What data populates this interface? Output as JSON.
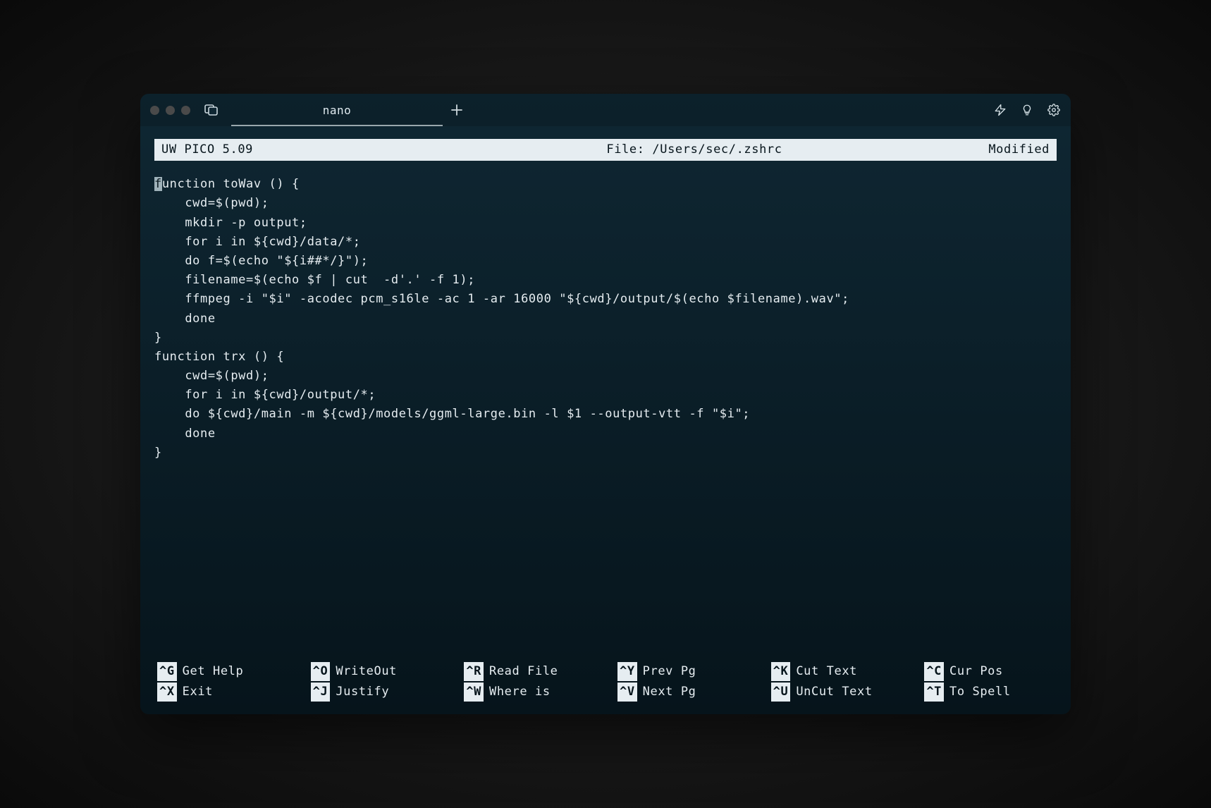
{
  "titlebar": {
    "tab_label": "nano"
  },
  "editor": {
    "app": "UW PICO 5.09",
    "file_label": "File: /Users/sec/.zshrc",
    "modified": "Modified",
    "cursor_char": "f",
    "content_after_cursor": "unction toWav () {\n    cwd=$(pwd);\n    mkdir -p output;\n    for i in ${cwd}/data/*;\n    do f=$(echo \"${i##*/}\");\n    filename=$(echo $f | cut  -d'.' -f 1);\n    ffmpeg -i \"$i\" -acodec pcm_s16le -ac 1 -ar 16000 \"${cwd}/output/$(echo $filename).wav\";\n    done\n}\nfunction trx () {\n    cwd=$(pwd);\n    for i in ${cwd}/output/*;\n    do ${cwd}/main -m ${cwd}/models/ggml-large.bin -l $1 --output-vtt -f \"$i\";\n    done\n}"
  },
  "shortcuts": [
    {
      "key": "^G",
      "label": "Get Help"
    },
    {
      "key": "^X",
      "label": "Exit"
    },
    {
      "key": "^O",
      "label": "WriteOut"
    },
    {
      "key": "^J",
      "label": "Justify"
    },
    {
      "key": "^R",
      "label": "Read File"
    },
    {
      "key": "^W",
      "label": "Where is"
    },
    {
      "key": "^Y",
      "label": "Prev Pg"
    },
    {
      "key": "^V",
      "label": "Next Pg"
    },
    {
      "key": "^K",
      "label": "Cut Text"
    },
    {
      "key": "^U",
      "label": "UnCut Text"
    },
    {
      "key": "^C",
      "label": "Cur Pos"
    },
    {
      "key": "^T",
      "label": "To Spell"
    }
  ]
}
